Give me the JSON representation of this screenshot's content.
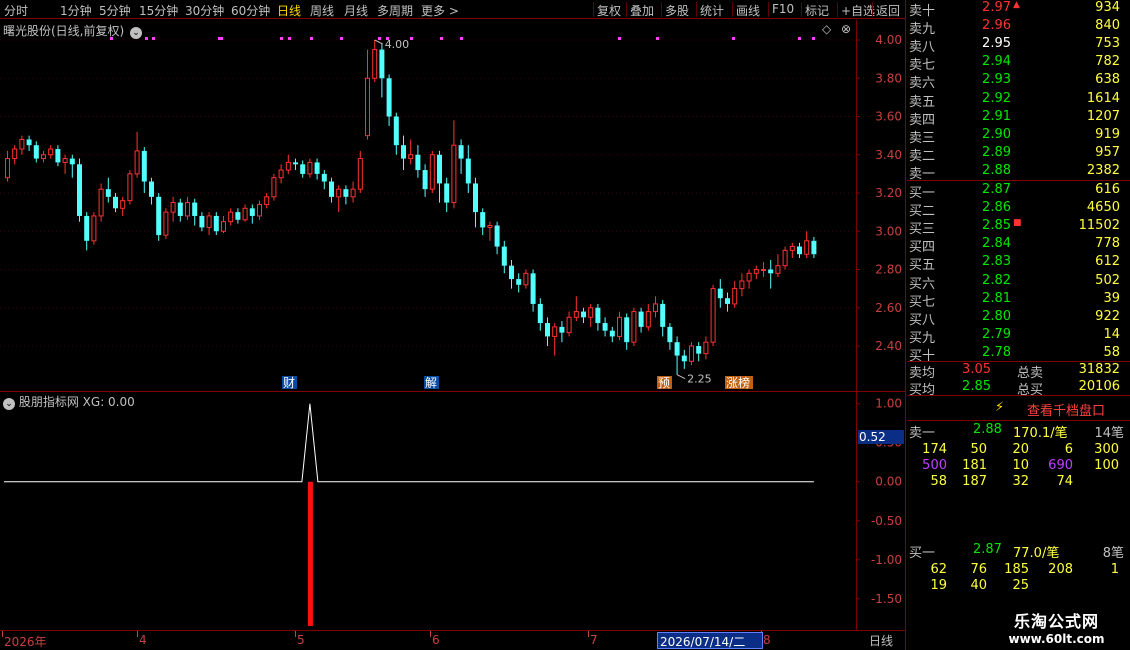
{
  "toolbar": {
    "left_items": [
      "分时",
      "1分钟",
      "5分钟",
      "15分钟",
      "30分钟",
      "60分钟",
      "日线",
      "周线",
      "月线",
      "多周期",
      "更多 >"
    ],
    "active_item": "日线",
    "right_items": [
      "复权",
      "叠加",
      "多股",
      "统计",
      "画线",
      "F10",
      "标记",
      "+自选",
      "返回"
    ]
  },
  "main_panel": {
    "title": "曙光股份(日线,前复权)",
    "y_ticks": [
      "4.00",
      "3.80",
      "3.60",
      "3.40",
      "3.20",
      "3.00",
      "2.80",
      "2.60",
      "2.40"
    ],
    "high_label": "4.00",
    "low_label": "2.25",
    "event_tags": [
      {
        "text": "财",
        "kind": "blue"
      },
      {
        "text": "解",
        "kind": "blue"
      },
      {
        "text": "预",
        "kind": "orange"
      },
      {
        "text": "涨榜",
        "kind": "orange"
      }
    ]
  },
  "indicator_panel": {
    "title": "股朋指标网",
    "series_label": "XG: 0.00",
    "y_ticks": [
      "1.00",
      "0.50",
      "0.00",
      "-0.50",
      "-1.00",
      "-1.50"
    ],
    "cursor_value": "0.52"
  },
  "x_axis": {
    "labels": [
      "2026年",
      "4",
      "5",
      "6",
      "7",
      "8"
    ],
    "cursor_date": "2026/07/14/二",
    "period": "日线"
  },
  "orderbook": {
    "asks": [
      {
        "label": "卖十",
        "price": "2.97",
        "volume": "934",
        "marker": "▲"
      },
      {
        "label": "卖九",
        "price": "2.96",
        "volume": "840",
        "marker": ""
      },
      {
        "label": "卖八",
        "price": "2.95",
        "volume": "753",
        "marker": ""
      },
      {
        "label": "卖七",
        "price": "2.94",
        "volume": "782",
        "marker": ""
      },
      {
        "label": "卖六",
        "price": "2.93",
        "volume": "638",
        "marker": ""
      },
      {
        "label": "卖五",
        "price": "2.92",
        "volume": "1614",
        "marker": ""
      },
      {
        "label": "卖四",
        "price": "2.91",
        "volume": "1207",
        "marker": ""
      },
      {
        "label": "卖三",
        "price": "2.90",
        "volume": "919",
        "marker": ""
      },
      {
        "label": "卖二",
        "price": "2.89",
        "volume": "957",
        "marker": ""
      },
      {
        "label": "卖一",
        "price": "2.88",
        "volume": "2382",
        "marker": ""
      }
    ],
    "bids": [
      {
        "label": "买一",
        "price": "2.87",
        "volume": "616",
        "marker": ""
      },
      {
        "label": "买二",
        "price": "2.86",
        "volume": "4650",
        "marker": ""
      },
      {
        "label": "买三",
        "price": "2.85",
        "volume": "11502",
        "marker": "■"
      },
      {
        "label": "买四",
        "price": "2.84",
        "volume": "778",
        "marker": ""
      },
      {
        "label": "买五",
        "price": "2.83",
        "volume": "612",
        "marker": ""
      },
      {
        "label": "买六",
        "price": "2.82",
        "volume": "502",
        "marker": ""
      },
      {
        "label": "买七",
        "price": "2.81",
        "volume": "39",
        "marker": ""
      },
      {
        "label": "买八",
        "price": "2.80",
        "volume": "922",
        "marker": ""
      },
      {
        "label": "买九",
        "price": "2.79",
        "volume": "14",
        "marker": ""
      },
      {
        "label": "买十",
        "price": "2.78",
        "volume": "58",
        "marker": ""
      }
    ],
    "summary": [
      {
        "label": "卖均",
        "price": "3.05",
        "total_label": "总卖",
        "total": "31832"
      },
      {
        "label": "买均",
        "price": "2.85",
        "total_label": "总买",
        "total": "20106"
      }
    ]
  },
  "tick_panel": {
    "button_label": "查看千档盘口",
    "sell": {
      "label": "卖一",
      "price": "2.88",
      "per_order": "170.1/笔",
      "count": "14笔",
      "rows": [
        [
          "174",
          "50",
          "20",
          "6",
          "300"
        ],
        [
          "500",
          "181",
          "10",
          "690",
          "100"
        ],
        [
          "58",
          "187",
          "32",
          "74",
          ""
        ]
      ]
    },
    "buy": {
      "label": "买一",
      "price": "2.87",
      "per_order": "77.0/笔",
      "count": "8笔",
      "rows": [
        [
          "62",
          "76",
          "185",
          "208",
          "1"
        ],
        [
          "19",
          "40",
          "25",
          "",
          ""
        ]
      ]
    }
  },
  "watermark": {
    "name": "乐淘公式网",
    "url": "www.60lt.com"
  },
  "colors": {
    "up": "#ff3232",
    "down": "#54ffff",
    "ask_price": "#00e600",
    "bid_price": "#00e600",
    "grid": "#800000",
    "accent": "#ffd800"
  },
  "chart_data": {
    "type": "candlestick",
    "title": "曙光股份(日线,前复权)",
    "ylim": [
      2.25,
      4.05
    ],
    "high": 4.0,
    "low": 2.25,
    "candles": [
      [
        3.28,
        3.38,
        3.42,
        3.26
      ],
      [
        3.38,
        3.43,
        3.45,
        3.35
      ],
      [
        3.43,
        3.48,
        3.5,
        3.4
      ],
      [
        3.48,
        3.45,
        3.5,
        3.42
      ],
      [
        3.45,
        3.38,
        3.47,
        3.36
      ],
      [
        3.38,
        3.4,
        3.42,
        3.36
      ],
      [
        3.4,
        3.43,
        3.45,
        3.38
      ],
      [
        3.43,
        3.36,
        3.45,
        3.34
      ],
      [
        3.36,
        3.38,
        3.4,
        3.3
      ],
      [
        3.38,
        3.35,
        3.4,
        3.28
      ],
      [
        3.35,
        3.08,
        3.38,
        3.05
      ],
      [
        3.08,
        2.95,
        3.1,
        2.9
      ],
      [
        2.95,
        3.08,
        3.1,
        2.93
      ],
      [
        3.08,
        3.22,
        3.25,
        3.05
      ],
      [
        3.22,
        3.18,
        3.28,
        3.15
      ],
      [
        3.18,
        3.12,
        3.2,
        3.1
      ],
      [
        3.12,
        3.16,
        3.18,
        3.08
      ],
      [
        3.16,
        3.3,
        3.32,
        3.14
      ],
      [
        3.3,
        3.42,
        3.52,
        3.28
      ],
      [
        3.42,
        3.26,
        3.44,
        3.2
      ],
      [
        3.26,
        3.18,
        3.28,
        3.14
      ],
      [
        3.18,
        2.98,
        3.2,
        2.95
      ],
      [
        2.98,
        3.1,
        3.12,
        2.96
      ],
      [
        3.1,
        3.15,
        3.18,
        3.05
      ],
      [
        3.15,
        3.08,
        3.17,
        3.05
      ],
      [
        3.08,
        3.15,
        3.18,
        3.06
      ],
      [
        3.15,
        3.08,
        3.17,
        3.03
      ],
      [
        3.08,
        3.02,
        3.1,
        3.0
      ],
      [
        3.02,
        3.08,
        3.1,
        2.98
      ],
      [
        3.08,
        3.0,
        3.1,
        2.98
      ],
      [
        3.0,
        3.05,
        3.08,
        2.99
      ],
      [
        3.05,
        3.1,
        3.12,
        3.03
      ],
      [
        3.1,
        3.06,
        3.12,
        3.04
      ],
      [
        3.06,
        3.12,
        3.14,
        3.05
      ],
      [
        3.12,
        3.08,
        3.14,
        3.04
      ],
      [
        3.08,
        3.14,
        3.16,
        3.06
      ],
      [
        3.14,
        3.18,
        3.2,
        3.12
      ],
      [
        3.18,
        3.28,
        3.3,
        3.16
      ],
      [
        3.28,
        3.32,
        3.35,
        3.25
      ],
      [
        3.32,
        3.36,
        3.4,
        3.3
      ],
      [
        3.36,
        3.35,
        3.38,
        3.32
      ],
      [
        3.35,
        3.3,
        3.37,
        3.28
      ],
      [
        3.3,
        3.36,
        3.38,
        3.28
      ],
      [
        3.36,
        3.3,
        3.38,
        3.27
      ],
      [
        3.3,
        3.26,
        3.32,
        3.22
      ],
      [
        3.26,
        3.18,
        3.28,
        3.15
      ],
      [
        3.18,
        3.22,
        3.24,
        3.1
      ],
      [
        3.22,
        3.18,
        3.24,
        3.14
      ],
      [
        3.18,
        3.22,
        3.26,
        3.15
      ],
      [
        3.22,
        3.38,
        3.42,
        3.2
      ],
      [
        3.5,
        3.8,
        3.95,
        3.48
      ],
      [
        3.8,
        3.95,
        4.0,
        3.78
      ],
      [
        3.95,
        3.8,
        3.98,
        3.7
      ],
      [
        3.8,
        3.6,
        3.82,
        3.55
      ],
      [
        3.6,
        3.45,
        3.62,
        3.4
      ],
      [
        3.45,
        3.38,
        3.5,
        3.32
      ],
      [
        3.38,
        3.4,
        3.48,
        3.35
      ],
      [
        3.4,
        3.32,
        3.45,
        3.28
      ],
      [
        3.32,
        3.22,
        3.35,
        3.18
      ],
      [
        3.22,
        3.4,
        3.42,
        3.2
      ],
      [
        3.4,
        3.25,
        3.42,
        3.15
      ],
      [
        3.25,
        3.15,
        3.28,
        3.1
      ],
      [
        3.15,
        3.45,
        3.58,
        3.12
      ],
      [
        3.45,
        3.38,
        3.48,
        3.3
      ],
      [
        3.38,
        3.25,
        3.45,
        3.2
      ],
      [
        3.25,
        3.1,
        3.28,
        3.02
      ],
      [
        3.1,
        3.02,
        3.12,
        2.98
      ],
      [
        3.02,
        3.03,
        3.05,
        2.95
      ],
      [
        3.03,
        2.92,
        3.05,
        2.88
      ],
      [
        2.92,
        2.82,
        2.95,
        2.78
      ],
      [
        2.82,
        2.75,
        2.85,
        2.7
      ],
      [
        2.75,
        2.72,
        2.78,
        2.68
      ],
      [
        2.72,
        2.78,
        2.8,
        2.7
      ],
      [
        2.78,
        2.62,
        2.8,
        2.58
      ],
      [
        2.62,
        2.52,
        2.65,
        2.48
      ],
      [
        2.52,
        2.45,
        2.55,
        2.4
      ],
      [
        2.45,
        2.5,
        2.52,
        2.35
      ],
      [
        2.5,
        2.47,
        2.53,
        2.42
      ],
      [
        2.47,
        2.55,
        2.58,
        2.45
      ],
      [
        2.55,
        2.58,
        2.66,
        2.53
      ],
      [
        2.58,
        2.55,
        2.6,
        2.52
      ],
      [
        2.55,
        2.6,
        2.62,
        2.5
      ],
      [
        2.6,
        2.52,
        2.62,
        2.48
      ],
      [
        2.52,
        2.48,
        2.55,
        2.45
      ],
      [
        2.48,
        2.45,
        2.5,
        2.42
      ],
      [
        2.45,
        2.55,
        2.58,
        2.43
      ],
      [
        2.55,
        2.42,
        2.57,
        2.38
      ],
      [
        2.42,
        2.58,
        2.6,
        2.4
      ],
      [
        2.58,
        2.5,
        2.6,
        2.47
      ],
      [
        2.5,
        2.58,
        2.62,
        2.48
      ],
      [
        2.58,
        2.62,
        2.66,
        2.55
      ],
      [
        2.62,
        2.5,
        2.64,
        2.45
      ],
      [
        2.5,
        2.42,
        2.52,
        2.38
      ],
      [
        2.42,
        2.35,
        2.45,
        2.25
      ],
      [
        2.35,
        2.32,
        2.38,
        2.28
      ],
      [
        2.32,
        2.4,
        2.42,
        2.3
      ],
      [
        2.4,
        2.36,
        2.42,
        2.32
      ],
      [
        2.36,
        2.42,
        2.45,
        2.33
      ],
      [
        2.42,
        2.7,
        2.72,
        2.4
      ],
      [
        2.7,
        2.65,
        2.75,
        2.6
      ],
      [
        2.65,
        2.62,
        2.68,
        2.58
      ],
      [
        2.62,
        2.7,
        2.74,
        2.6
      ],
      [
        2.7,
        2.74,
        2.78,
        2.66
      ],
      [
        2.74,
        2.78,
        2.8,
        2.7
      ],
      [
        2.78,
        2.8,
        2.82,
        2.75
      ],
      [
        2.8,
        2.8,
        2.84,
        2.76
      ],
      [
        2.8,
        2.78,
        2.85,
        2.7
      ],
      [
        2.78,
        2.82,
        2.88,
        2.76
      ],
      [
        2.82,
        2.9,
        2.92,
        2.8
      ],
      [
        2.9,
        2.92,
        2.94,
        2.86
      ],
      [
        2.92,
        2.88,
        2.94,
        2.86
      ],
      [
        2.88,
        2.95,
        3.0,
        2.86
      ],
      [
        2.95,
        2.88,
        2.97,
        2.86
      ]
    ],
    "indicator": {
      "name": "XG",
      "y_range": [
        -1.9,
        1.15
      ],
      "signal_index": 42,
      "signal_peak": 1.0
    }
  }
}
